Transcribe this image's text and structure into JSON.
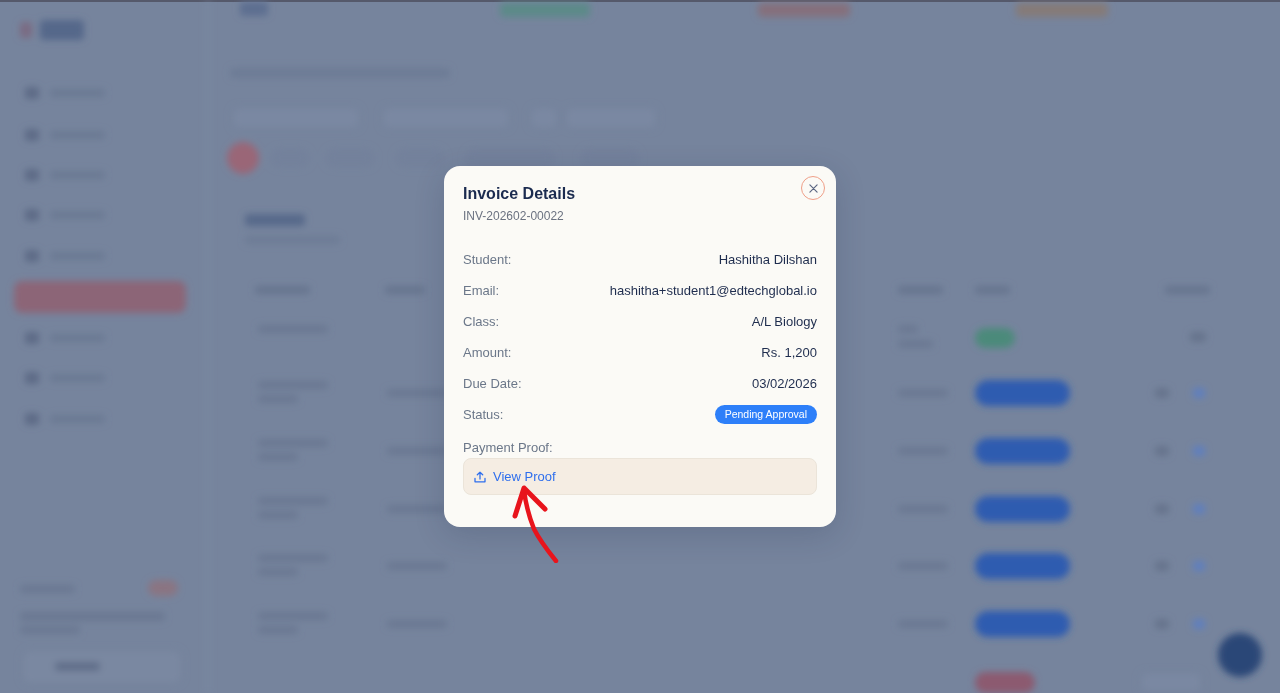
{
  "invoice_modal": {
    "title": "Invoice Details",
    "invoice_number": "INV-202602-00022",
    "fields": [
      {
        "label": "Student:",
        "value": "Hashitha Dilshan",
        "kind": "text"
      },
      {
        "label": "Email:",
        "value": "hashitha+student1@edtechglobal.io",
        "kind": "text"
      },
      {
        "label": "Class:",
        "value": "A/L Biology",
        "kind": "text"
      },
      {
        "label": "Amount:",
        "value": "Rs. 1,200",
        "kind": "text"
      },
      {
        "label": "Due Date:",
        "value": "03/02/2026",
        "kind": "text"
      },
      {
        "label": "Status:",
        "value": "Pending Approval",
        "kind": "badge"
      }
    ],
    "payment_proof": {
      "label": "Payment Proof:",
      "link": "View Proof"
    }
  }
}
